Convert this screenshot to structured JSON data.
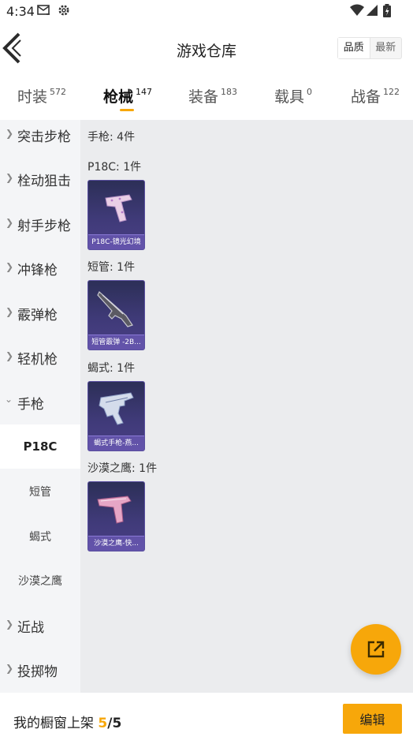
{
  "status_bar": {
    "time": "4:34"
  },
  "header": {
    "title": "游戏仓库",
    "sort_quality": "品质",
    "sort_latest": "最新"
  },
  "tabs": [
    {
      "label": "时装",
      "count": "572"
    },
    {
      "label": "枪械",
      "count": "147"
    },
    {
      "label": "装备",
      "count": "183"
    },
    {
      "label": "载具",
      "count": "0"
    },
    {
      "label": "战备",
      "count": "122"
    }
  ],
  "sidebar": {
    "categories": [
      "突击步枪",
      "栓动狙击",
      "射手步枪",
      "冲锋枪",
      "霰弹枪",
      "轻机枪",
      "手枪"
    ],
    "pistol_subs": [
      "P18C",
      "短管",
      "蝎式",
      "沙漠之鹰"
    ],
    "more_categories": [
      "近战",
      "投掷物"
    ]
  },
  "content": {
    "summary": "手枪: 4件",
    "groups": [
      {
        "header": "P18C: 1件",
        "item": "P18C-镜光幻境"
      },
      {
        "header": "短管: 1件",
        "item": "短管霰弹 -2B..."
      },
      {
        "header": "蝎式: 1件",
        "item": "蝎式手枪-燕..."
      },
      {
        "header": "沙漠之鹰: 1件",
        "item": "沙漠之鹰-快..."
      }
    ]
  },
  "bottom": {
    "label": "我的橱窗上架",
    "count": "5",
    "total": "/5",
    "edit_label": "编辑"
  },
  "colors": {
    "accent": "#f7a70a",
    "sidebar_bg": "#f4f5f7",
    "content_bg": "#ebecee"
  }
}
